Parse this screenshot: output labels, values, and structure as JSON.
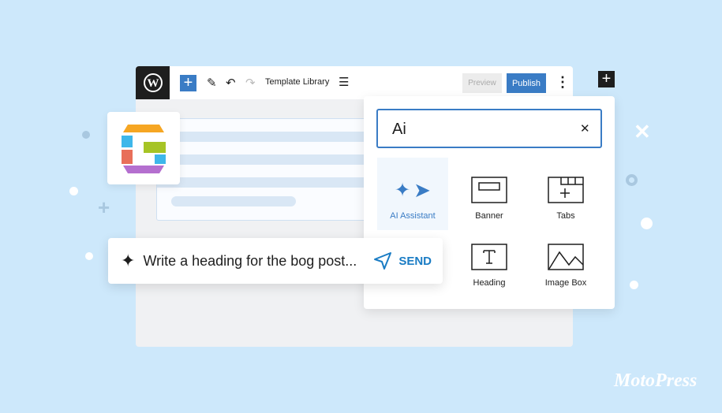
{
  "toolbar": {
    "title": "Template Library",
    "preview": "Preview",
    "publish": "Publish"
  },
  "search": {
    "value": "Ai"
  },
  "blocks": [
    {
      "label": "AI Assistant"
    },
    {
      "label": "Banner"
    },
    {
      "label": "Tabs"
    },
    {
      "label": "Heading"
    },
    {
      "label": "Image Box"
    }
  ],
  "prompt": {
    "text": "Write a heading for the bog post...",
    "send": "SEND"
  },
  "brand": "MotoPress",
  "colors": {
    "accent": "#3a7cc5",
    "background": "#cde8fb",
    "send": "#1a7cc4"
  }
}
